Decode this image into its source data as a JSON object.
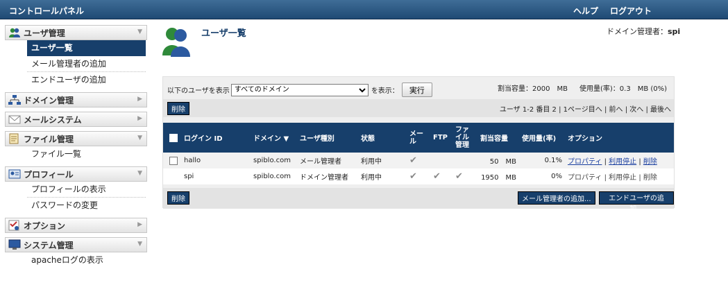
{
  "topbar": {
    "title": "コントロールパネル",
    "help": "ヘルプ",
    "logout": "ログアウト"
  },
  "sidebar": {
    "user_mgmt": {
      "label": "ユーザ管理",
      "items": [
        "ユーザ一覧",
        "メール管理者の追加",
        "エンドユーザの追加"
      ]
    },
    "domain_mgmt": {
      "label": "ドメイン管理"
    },
    "mail_system": {
      "label": "メールシステム"
    },
    "file_mgmt": {
      "label": "ファイル管理",
      "items": [
        "ファイル一覧"
      ]
    },
    "profile": {
      "label": "プロフィール",
      "items": [
        "プロフィールの表示",
        "パスワードの変更"
      ]
    },
    "options": {
      "label": "オプション"
    },
    "system_mgmt": {
      "label": "システム管理",
      "items": [
        "apacheログの表示"
      ]
    }
  },
  "main": {
    "title": "ユーザ一覧",
    "admin_label": "ドメイン管理者：",
    "admin_name": "spi",
    "filter": {
      "prefix": "以下のユーザを表示",
      "selected": "すべてのドメイン",
      "suffix": "を表示：",
      "exec": "実行"
    },
    "quota": "割当容量：2000　MB",
    "usage": "使用量(率)：0.3　MB (0%)",
    "delete": "削除",
    "pager": "ユーザ 1-2 番目 2 | 1ページ目へ | 前へ | 次へ | 最後へ",
    "columns": {
      "login": "ログイン ID",
      "domain": "ドメイン ▼",
      "type": "ユーザ種別",
      "status": "状態",
      "mail": "メー\nル",
      "ftp": "FTP",
      "file": "ファ\nイル\n管理",
      "quota": "割当容量",
      "usage": "使用量(率)",
      "options": "オプション"
    },
    "rows": [
      {
        "login": "hallo",
        "domain": "spiblo.com",
        "type": "メール管理者",
        "status": "利用中",
        "quota": "50　MB",
        "usage": "0.1%",
        "opt1": "プロパティ",
        "opt2": "利用停止",
        "opt3": "削除"
      },
      {
        "login": "spi",
        "domain": "spiblo.com",
        "type": "ドメイン管理者",
        "status": "利用中",
        "quota": "1950　MB",
        "usage": "0%",
        "opt1": "プロパティ",
        "opt2": "利用停止",
        "opt3": "削除"
      }
    ],
    "add_mail_admin": "メール管理者の追加...",
    "add_end_user": "エンドユーザの追加..."
  },
  "colors": {
    "accent": "#173f6b",
    "link": "#1a3fa0"
  }
}
